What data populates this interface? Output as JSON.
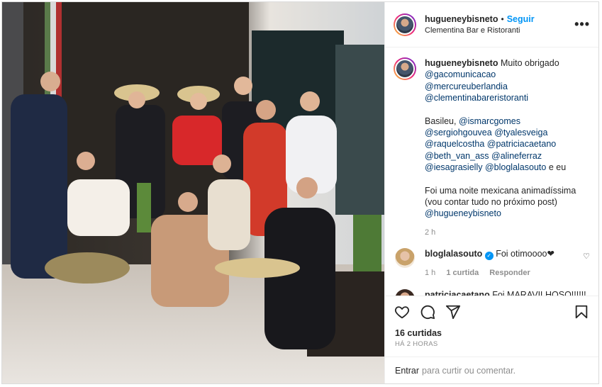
{
  "post": {
    "author": "hugueneybisneto",
    "follow_label": "Seguir",
    "location": "Clementina Bar e Ristoranti",
    "more_label": "•••"
  },
  "caption": {
    "author": "hugueneybisneto",
    "intro": "Muito obrigado",
    "tags_a": [
      "@gacomunicacao",
      "@mercureuberlandia",
      "@clementinabareristoranti"
    ],
    "basileu_prefix": "Basileu,",
    "line_1": [
      "@ismarcgomes"
    ],
    "line_2": [
      "@sergiohgouvea",
      "@tyalesveiga"
    ],
    "line_3": [
      "@raquelcostha",
      "@patriciacaetano"
    ],
    "line_4": [
      "@beth_van_ass",
      "@alineferraz"
    ],
    "line_5": [
      "@iesagrasielly",
      "@bloglalasouto"
    ],
    "line_5_suffix": "e eu",
    "outro_1": "Foi uma noite mexicana animadíssima",
    "outro_2": "(vou contar tudo no próximo post)",
    "outro_tag": "@hugueneybisneto",
    "time": "2 h"
  },
  "comments": [
    {
      "author": "bloglalasouto",
      "verified": true,
      "text": "Foi otimoooo❤",
      "time": "1 h",
      "likes": "1 curtida",
      "reply": "Responder"
    },
    {
      "author": "patriciacaetano",
      "text": "Foi MARAVILHOSO!!!!!!"
    }
  ],
  "actions": {
    "like": "heart-icon",
    "comment": "comment-icon",
    "share": "share-icon",
    "save": "bookmark-icon"
  },
  "likes_count": "16 curtidas",
  "posted_ago": "HÁ 2 HORAS",
  "login": {
    "link": "Entrar",
    "rest": "para curtir ou comentar."
  },
  "colors": {
    "accent": "#0095f6",
    "link": "#00376b",
    "muted": "#8e8e8e"
  }
}
